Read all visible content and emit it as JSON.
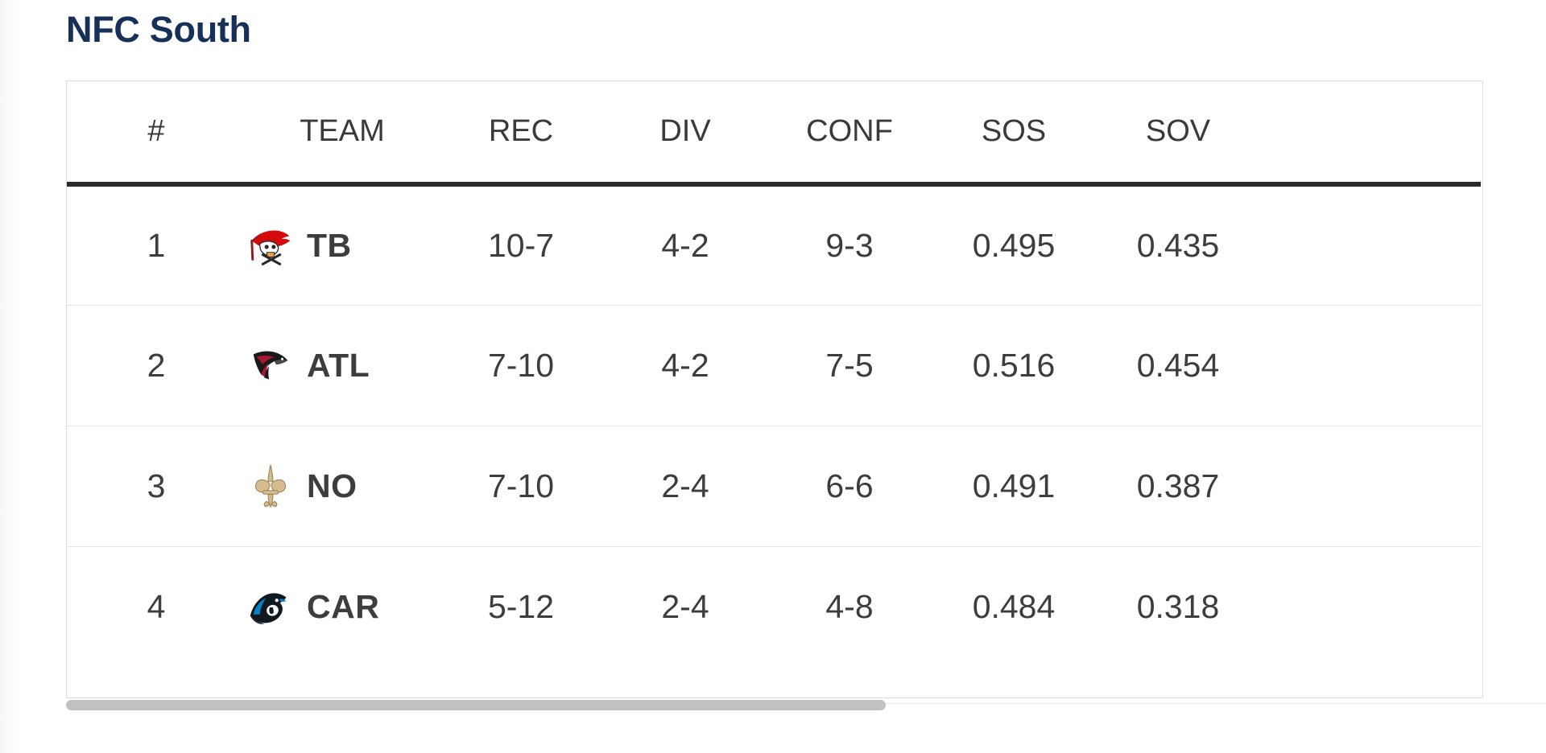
{
  "page": {
    "title": "NFC South",
    "title_color": "#16305a"
  },
  "table": {
    "columns": [
      {
        "key": "rank",
        "label": "#"
      },
      {
        "key": "team",
        "label": "TEAM"
      },
      {
        "key": "rec",
        "label": "REC"
      },
      {
        "key": "div",
        "label": "DIV"
      },
      {
        "key": "conf",
        "label": "CONF"
      },
      {
        "key": "sos",
        "label": "SOS"
      },
      {
        "key": "sov",
        "label": "SOV"
      }
    ],
    "rows": [
      {
        "rank": "1",
        "team": "TB",
        "team_logo": "buccaneers-logo",
        "rec": "10-7",
        "div": "4-2",
        "conf": "9-3",
        "sos": "0.495",
        "sov": "0.435"
      },
      {
        "rank": "2",
        "team": "ATL",
        "team_logo": "falcons-logo",
        "rec": "7-10",
        "div": "4-2",
        "conf": "7-5",
        "sos": "0.516",
        "sov": "0.454"
      },
      {
        "rank": "3",
        "team": "NO",
        "team_logo": "saints-logo",
        "rec": "7-10",
        "div": "2-4",
        "conf": "6-6",
        "sos": "0.491",
        "sov": "0.387"
      },
      {
        "rank": "4",
        "team": "CAR",
        "team_logo": "panthers-logo",
        "rec": "5-12",
        "div": "2-4",
        "conf": "4-8",
        "sos": "0.484",
        "sov": "0.318"
      }
    ]
  },
  "colors": {
    "buccaneers_red": "#d50a0a",
    "buccaneers_dark": "#8d1c1c",
    "falcons_red": "#a71930",
    "falcons_black": "#1a1a1a",
    "saints_gold": "#d3bc8d",
    "saints_dark": "#a08858",
    "panthers_blue": "#0085ca",
    "panthers_black": "#101820",
    "header_rule": "#2a2a2a",
    "row_rule": "#e6e6e6",
    "scrollbar_thumb": "#c1c1c1"
  },
  "scrollbar": {
    "orientation": "horizontal",
    "thumb_label": "table-horizontal-scroll"
  }
}
